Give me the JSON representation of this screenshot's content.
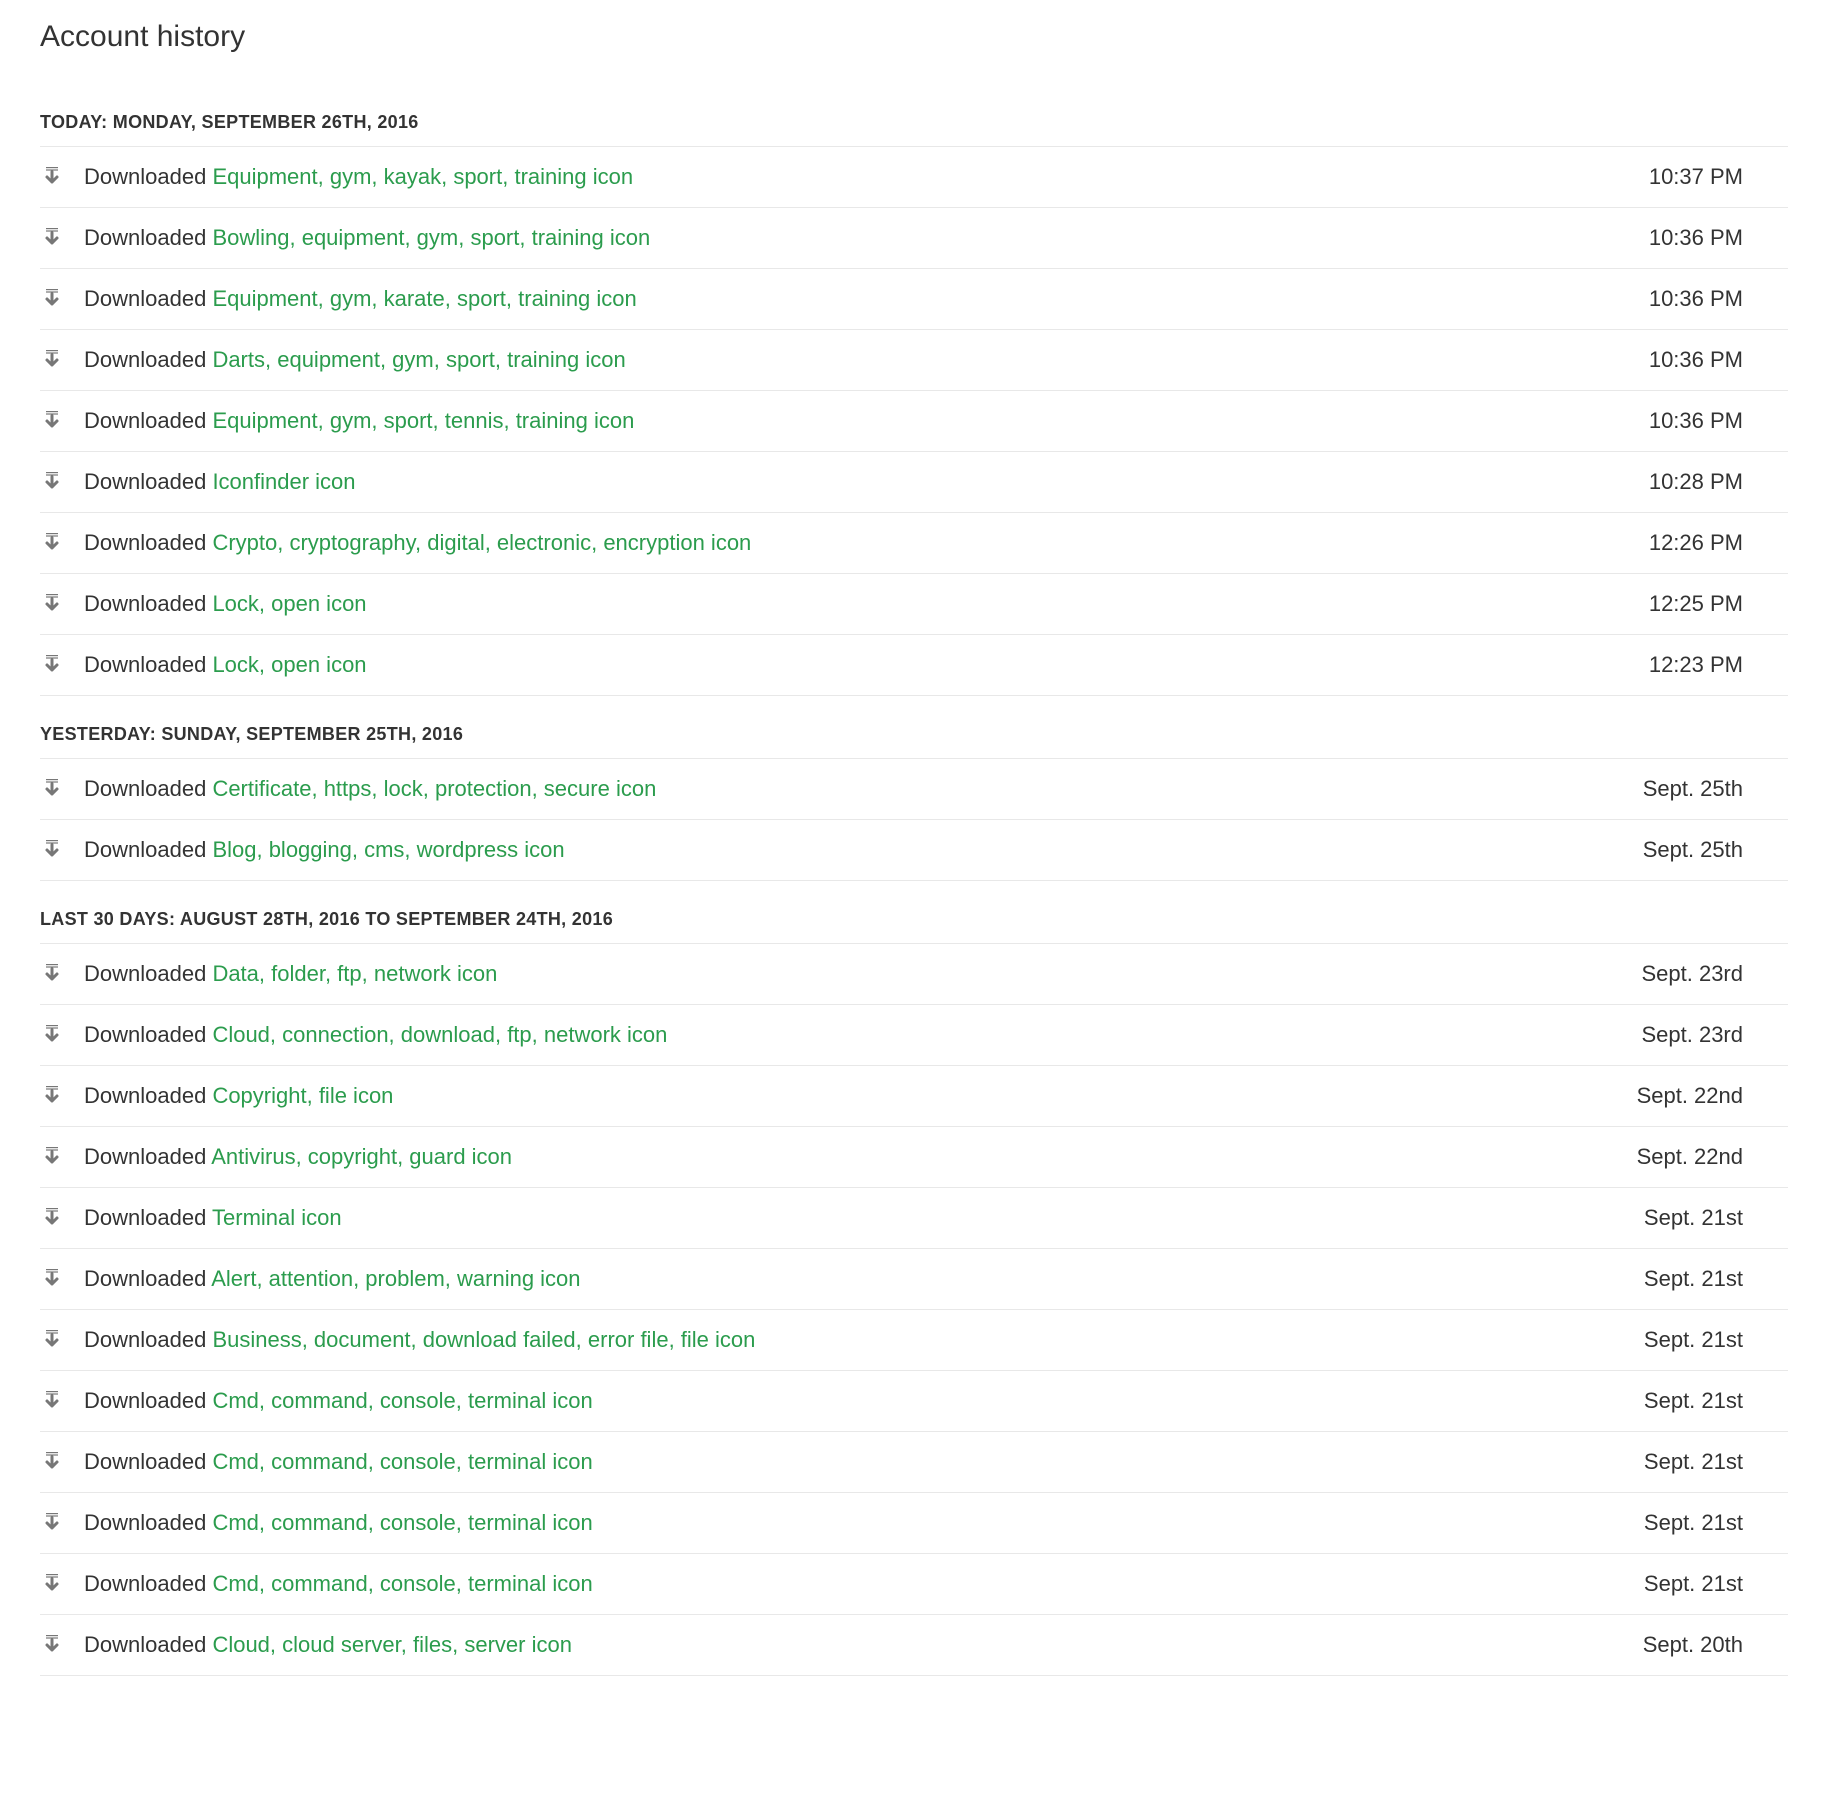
{
  "title": "Account history",
  "action_label": "Downloaded",
  "sections": [
    {
      "heading": "TODAY: MONDAY, SEPTEMBER 26TH, 2016",
      "items": [
        {
          "link": "Equipment, gym, kayak, sport, training icon",
          "time": "10:37 PM"
        },
        {
          "link": "Bowling, equipment, gym, sport, training icon",
          "time": "10:36 PM"
        },
        {
          "link": "Equipment, gym, karate, sport, training icon",
          "time": "10:36 PM"
        },
        {
          "link": "Darts, equipment, gym, sport, training icon",
          "time": "10:36 PM"
        },
        {
          "link": "Equipment, gym, sport, tennis, training icon",
          "time": "10:36 PM"
        },
        {
          "link": "Iconfinder icon",
          "time": "10:28 PM"
        },
        {
          "link": "Crypto, cryptography, digital, electronic, encryption icon",
          "time": "12:26 PM"
        },
        {
          "link": "Lock, open icon",
          "time": "12:25 PM"
        },
        {
          "link": "Lock, open icon",
          "time": "12:23 PM"
        }
      ]
    },
    {
      "heading": "YESTERDAY: SUNDAY, SEPTEMBER 25TH, 2016",
      "items": [
        {
          "link": "Certificate, https, lock, protection, secure icon",
          "time": "Sept. 25th"
        },
        {
          "link": "Blog, blogging, cms, wordpress icon",
          "time": "Sept. 25th"
        }
      ]
    },
    {
      "heading": "LAST 30 DAYS: AUGUST 28TH, 2016 TO SEPTEMBER 24TH, 2016",
      "items": [
        {
          "link": "Data, folder, ftp, network icon",
          "time": "Sept. 23rd"
        },
        {
          "link": "Cloud, connection, download, ftp, network icon",
          "time": "Sept. 23rd"
        },
        {
          "link": "Copyright, file icon",
          "time": "Sept. 22nd"
        },
        {
          "link": "Antivirus, copyright, guard icon",
          "time": "Sept. 22nd"
        },
        {
          "link": "Terminal icon",
          "time": "Sept. 21st"
        },
        {
          "link": "Alert, attention, problem, warning icon",
          "time": "Sept. 21st"
        },
        {
          "link": "Business, document, download failed, error file, file icon",
          "time": "Sept. 21st"
        },
        {
          "link": "Cmd, command, console, terminal icon",
          "time": "Sept. 21st"
        },
        {
          "link": "Cmd, command, console, terminal icon",
          "time": "Sept. 21st"
        },
        {
          "link": "Cmd, command, console, terminal icon",
          "time": "Sept. 21st"
        },
        {
          "link": "Cmd, command, console, terminal icon",
          "time": "Sept. 21st"
        },
        {
          "link": "Cloud, cloud server, files, server icon",
          "time": "Sept. 20th"
        }
      ]
    }
  ]
}
